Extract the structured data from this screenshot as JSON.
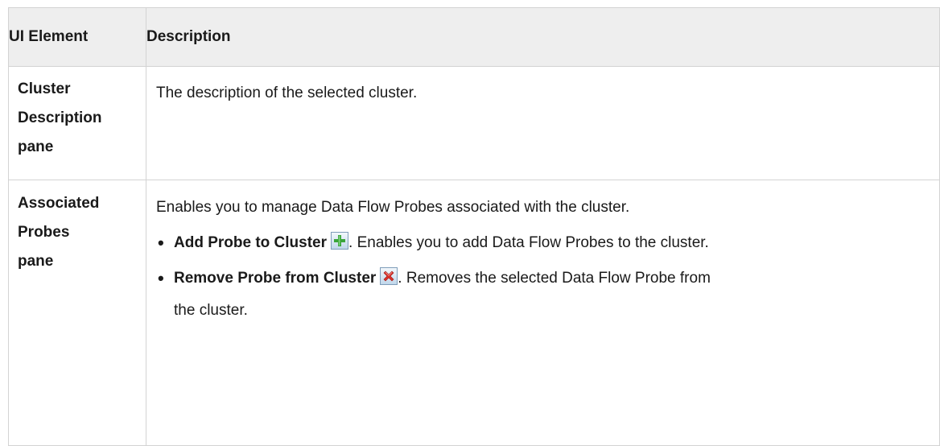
{
  "table": {
    "headers": {
      "element": "UI Element",
      "description": "Description"
    },
    "rows": [
      {
        "element": [
          "Cluster",
          "Description",
          "pane"
        ],
        "description": "The description of the selected cluster."
      },
      {
        "element": [
          "Associated",
          "Probes",
          "pane"
        ],
        "description": "Enables you to manage Data Flow Probes associated with the cluster.",
        "options": [
          {
            "name": "Add Probe to Cluster",
            "icon": "add-plus-icon",
            "text": ". Enables you to add Data Flow Probes to the cluster."
          },
          {
            "name": "Remove Probe from Cluster",
            "icon": "remove-x-icon",
            "text": ". Removes the selected Data Flow Probe from",
            "text_cont": "the cluster."
          }
        ]
      }
    ]
  },
  "colors": {
    "border": "#d3d3d3",
    "header_bg": "#eeeeee",
    "add_icon_green": "#3aa53a",
    "remove_icon_red": "#d9302a"
  }
}
